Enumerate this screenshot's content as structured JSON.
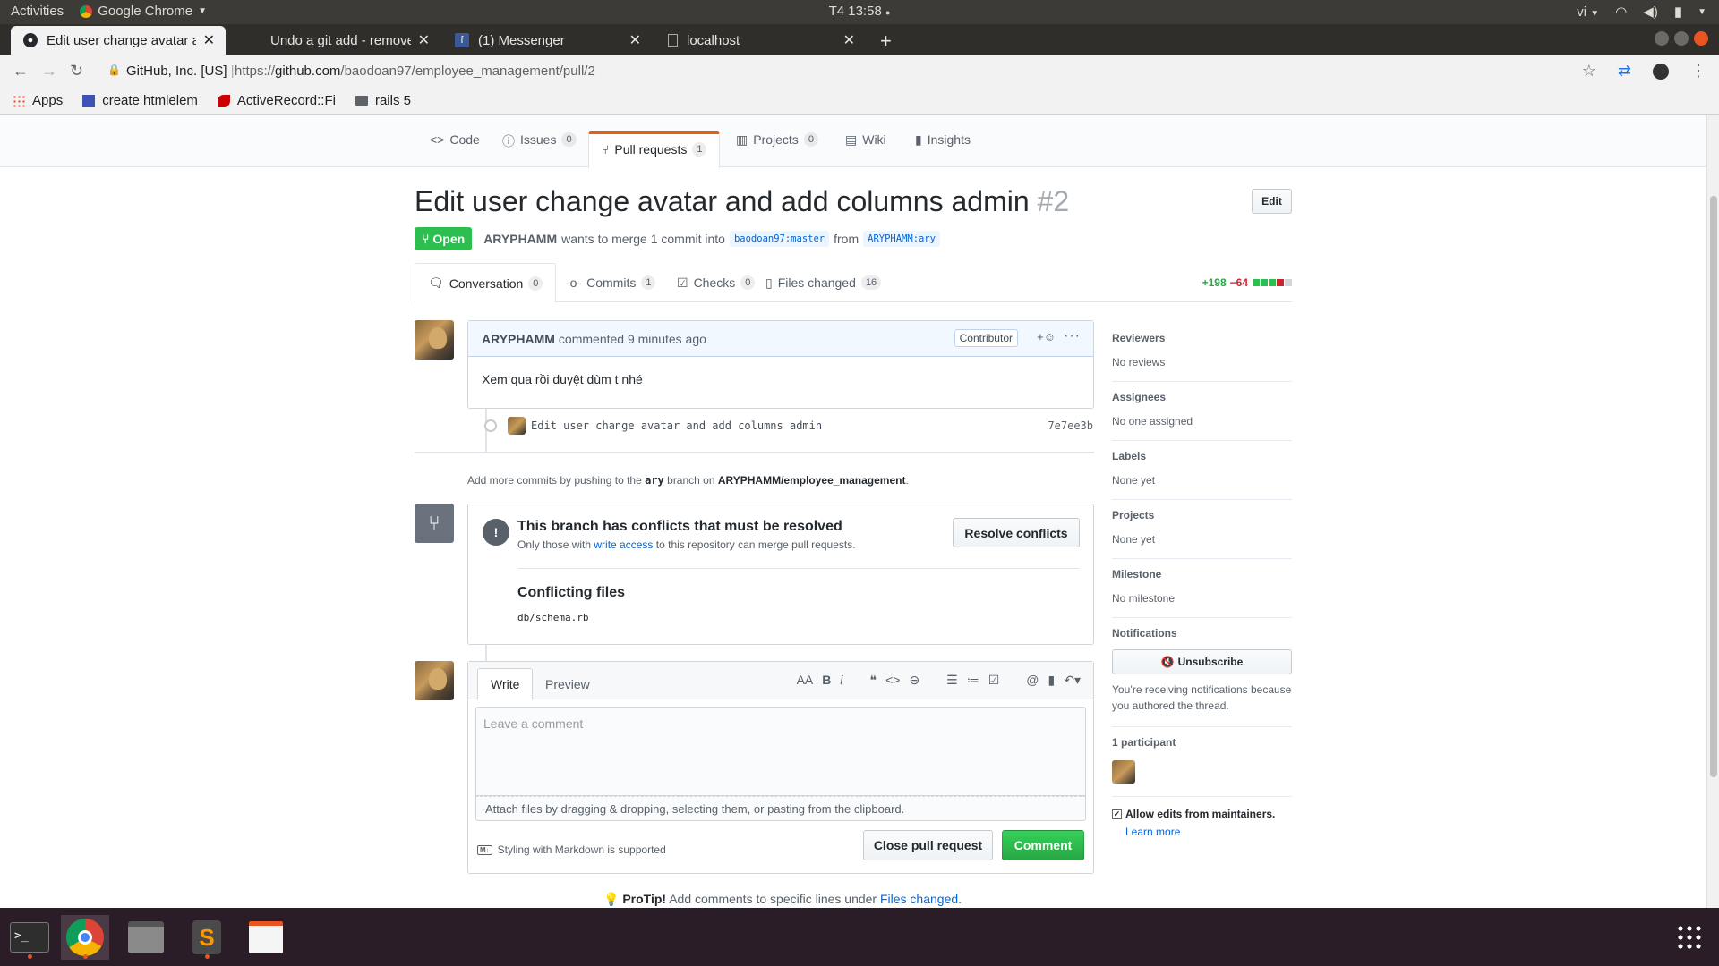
{
  "system": {
    "activities": "Activities",
    "app_name": "Google Chrome",
    "clock": "T4 13:58",
    "lang": "vi"
  },
  "tabs": [
    {
      "title": "Edit user change avatar and add columns admin",
      "active": true
    },
    {
      "title": "Undo a git add - remove files",
      "active": false
    },
    {
      "title": "(1) Messenger",
      "active": false
    },
    {
      "title": "localhost",
      "active": false
    }
  ],
  "address": {
    "site_identity": "GitHub, Inc. [US]",
    "url_prefix": "https://",
    "url_host": "github.com",
    "url_path": "/baodoan97/employee_management/pull/2"
  },
  "bookmarks": [
    {
      "label": "Apps",
      "icon": "apps-grid-icon"
    },
    {
      "label": "create htmlelem",
      "icon": "bookmark-page-icon"
    },
    {
      "label": "ActiveRecord::Fi",
      "icon": "rails-icon"
    },
    {
      "label": "rails 5",
      "icon": "folder-icon"
    }
  ],
  "repo_nav": [
    {
      "label": "Code",
      "count": null
    },
    {
      "label": "Issues",
      "count": "0"
    },
    {
      "label": "Pull requests",
      "count": "1"
    },
    {
      "label": "Projects",
      "count": "0"
    },
    {
      "label": "Wiki",
      "count": null
    },
    {
      "label": "Insights",
      "count": null
    }
  ],
  "pr": {
    "title": "Edit user change avatar and add columns admin",
    "number": "#2",
    "edit_label": "Edit",
    "state": "Open",
    "author": "ARYPHAMM",
    "merge_text": "wants to merge 1 commit into",
    "base_branch": "baodoan97:master",
    "from_text": "from",
    "head_branch": "ARYPHAMM:ary"
  },
  "pr_tabs": [
    {
      "label": "Conversation",
      "count": "0"
    },
    {
      "label": "Commits",
      "count": "1"
    },
    {
      "label": "Checks",
      "count": "0"
    },
    {
      "label": "Files changed",
      "count": "16"
    }
  ],
  "diffstat": {
    "additions": "+198",
    "deletions": "−64"
  },
  "comment": {
    "author": "ARYPHAMM",
    "action": "commented",
    "time": "9 minutes ago",
    "badge": "Contributor",
    "reaction": "+☺",
    "body": "Xem qua rồi duyệt dùm t nhé"
  },
  "commit": {
    "message": "Edit user change avatar and add columns admin",
    "sha": "7e7ee3b"
  },
  "push_hint": {
    "prefix": "Add more commits by pushing to the",
    "branch": "ary",
    "middle": "branch on",
    "repo": "ARYPHAMM/employee_management",
    "suffix": "."
  },
  "merge": {
    "title": "This branch has conflicts that must be resolved",
    "desc_prefix": "Only those with",
    "desc_link": "write access",
    "desc_suffix": "to this repository can merge pull requests.",
    "resolve_label": "Resolve conflicts",
    "conflicting_title": "Conflicting files",
    "conflicting_file": "db/schema.rb"
  },
  "editor": {
    "write_tab": "Write",
    "preview_tab": "Preview",
    "placeholder": "Leave a comment",
    "attach_hint": "Attach files by dragging & dropping, selecting them, or pasting from the clipboard.",
    "markdown_note": "Styling with Markdown is supported",
    "close_label": "Close pull request",
    "comment_label": "Comment"
  },
  "protip": {
    "label": "ProTip!",
    "text": "Add comments to specific lines under",
    "link": "Files changed",
    "end": "."
  },
  "sidebar": {
    "reviewers": {
      "title": "Reviewers",
      "value": "No reviews"
    },
    "assignees": {
      "title": "Assignees",
      "value": "No one assigned"
    },
    "labels": {
      "title": "Labels",
      "value": "None yet"
    },
    "projects": {
      "title": "Projects",
      "value": "None yet"
    },
    "milestone": {
      "title": "Milestone",
      "value": "No milestone"
    },
    "notifications": {
      "title": "Notifications",
      "button": "Unsubscribe",
      "help": "You’re receiving notifications because you authored the thread."
    },
    "participants": {
      "title": "1 participant"
    },
    "maintainers": {
      "label": "Allow edits from maintainers.",
      "link": "Learn more"
    }
  },
  "colors": {
    "open_green": "#2cbe4e",
    "link_blue": "#0366d6",
    "nav_accent": "#e36209",
    "ubuntu_orange": "#e95420"
  }
}
